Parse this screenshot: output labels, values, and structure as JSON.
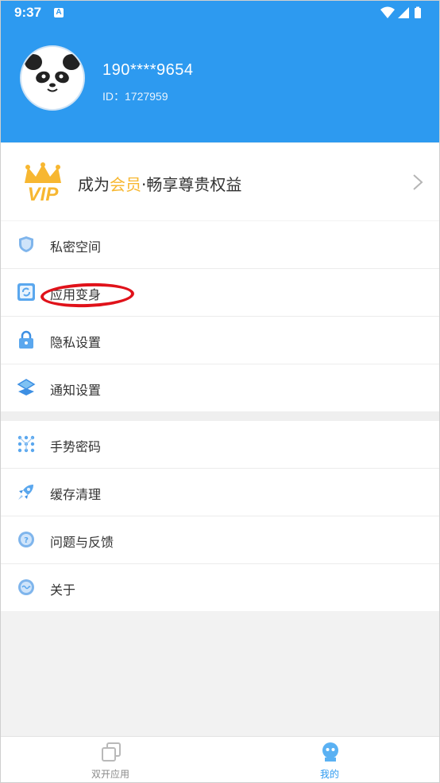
{
  "status_bar": {
    "time": "9:37",
    "badge": "A"
  },
  "profile": {
    "phone": "190****9654",
    "id_text": "ID：1727959"
  },
  "vip": {
    "prefix": "成为",
    "highlight": "会员",
    "suffix": "·畅享尊贵权益",
    "highlight_color": "#f7b731"
  },
  "menu_group1": [
    {
      "label": "私密空间",
      "icon": "shield-icon"
    },
    {
      "label": "应用变身",
      "icon": "refresh-icon"
    },
    {
      "label": "隐私设置",
      "icon": "lock-icon"
    },
    {
      "label": "通知设置",
      "icon": "layers-icon"
    }
  ],
  "menu_group2": [
    {
      "label": "手势密码",
      "icon": "gesture-icon"
    },
    {
      "label": "缓存清理",
      "icon": "rocket-icon"
    },
    {
      "label": "问题与反馈",
      "icon": "question-icon"
    },
    {
      "label": "关于",
      "icon": "info-icon"
    }
  ],
  "bottom_nav": [
    {
      "label": "双开应用",
      "active": false
    },
    {
      "label": "我的",
      "active": true
    }
  ],
  "colors": {
    "primary": "#2d9af0",
    "accent": "#f7b731",
    "annotation": "#e0121a"
  }
}
